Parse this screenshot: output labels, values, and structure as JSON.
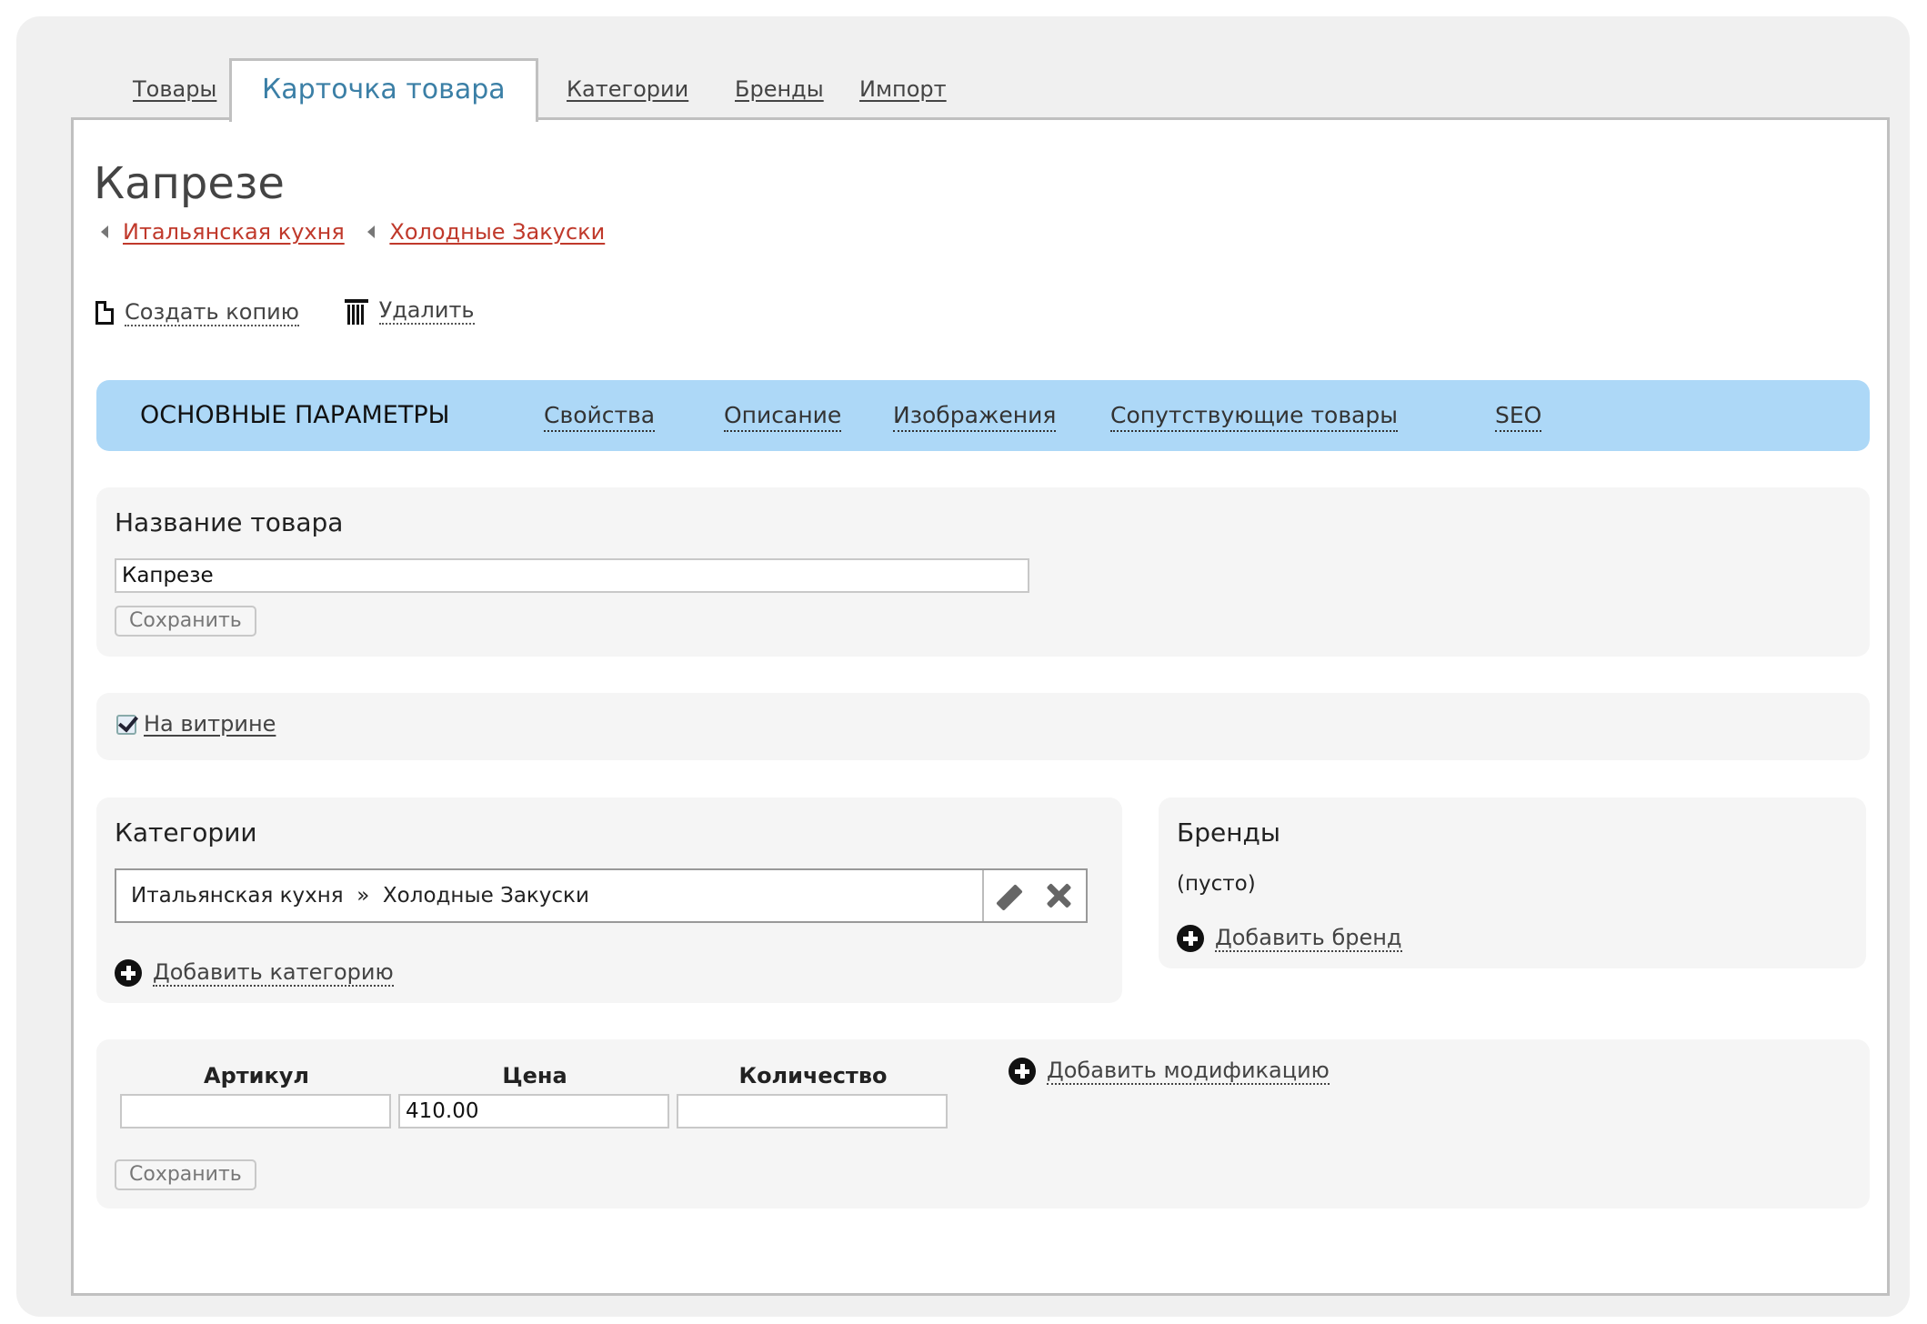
{
  "top_tabs": [
    "Товары",
    "Карточка товара",
    "Категории",
    "Бренды",
    "Импорт"
  ],
  "product": {
    "title": "Капрезе",
    "breadcrumbs": [
      "Итальянская кухня",
      "Холодные Закуски"
    ]
  },
  "actions": {
    "copy": "Создать копию",
    "delete": "Удалить"
  },
  "subnav": [
    "ОСНОВНЫЕ ПАРАМЕТРЫ",
    "Свойства",
    "Описание",
    "Изображения",
    "Сопутствующие товары",
    "SEO"
  ],
  "name_section": {
    "heading": "Название товара",
    "value": "Капрезе",
    "save": "Сохранить"
  },
  "showcase": {
    "label": "На витрине",
    "checked": true
  },
  "categories": {
    "heading": "Категории",
    "path": "Итальянская кухня  »  Холодные Закуски",
    "add": "Добавить категорию"
  },
  "brands": {
    "heading": "Бренды",
    "empty": "(пусто)",
    "add": "Добавить бренд"
  },
  "variants": {
    "col_sku": "Артикул",
    "col_price": "Цена",
    "col_qty": "Количество",
    "sku": "",
    "price": "410.00",
    "qty": "",
    "add": "Добавить модификацию",
    "save": "Сохранить"
  }
}
